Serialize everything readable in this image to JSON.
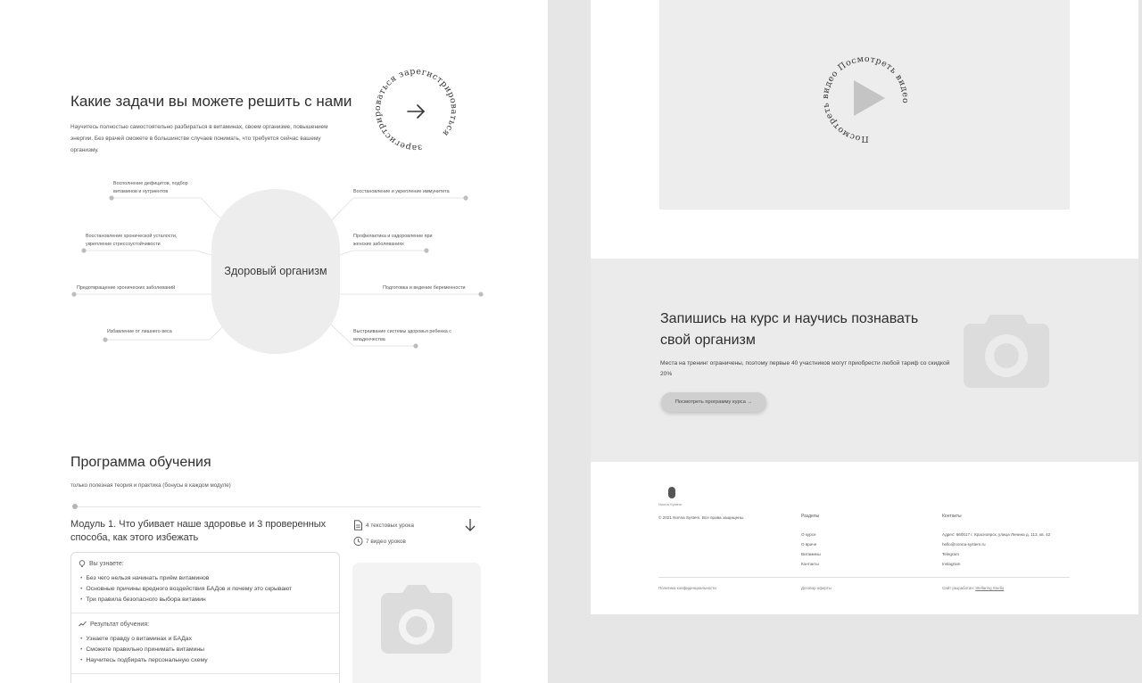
{
  "tasks": {
    "title": "Какие задачи вы можете решить с нами",
    "description": "Научитесь полностью самостоятельно разбираться в витаминах, своем организме, повышением энергии. Без врачей сможете в большинстве случаев понимать, что требуется сейчас вашему организму.",
    "register_ring_text": "зарегистрироваться зарегистрироваться",
    "center_label": "Здоровый организм",
    "nodes_left": [
      "Восполнение дефицитов, подбор витаминов и нутриентов",
      "Восстановление хронической усталости, укрепление стрессоустойчивости",
      "Предотвращение хронических заболеваний",
      "Избавление от лишнего веса"
    ],
    "nodes_right": [
      "Восстановление и укрепление иммунитета",
      "Профилактика и оздоровление при женских заболеваниях",
      "Подготовка и ведение беременности",
      "Выстраивание системы здоровья ребенка с младенчества"
    ]
  },
  "program": {
    "title": "Программа обучения",
    "subtitle": "только полезная теория и практика (бонусы в каждом модуле)",
    "module": {
      "title": "Модуль 1. Что убивает наше здоровье и 3 проверенных способа, как этого избежать",
      "text_lessons": "4 текстовых урока",
      "video_lessons": "7 видео уроков",
      "learn_heading": "Вы узнаете:",
      "learn_items": [
        "Без чего нельзя начинать приём витаминов",
        "Основные причины вредного воздействия БАДов и почему это скрывают",
        "Три правила безопасного выбора витамин"
      ],
      "result_heading": "Результат обучения:",
      "result_items": [
        "Узнаете правду о витаминах и БАДах",
        "Сможете правильно принимать витамины",
        "Научитесь подбирать персональную схему"
      ]
    }
  },
  "video": {
    "ring_text": "Посмотреть видео Посмотреть видео"
  },
  "signup": {
    "title": "Запишись на курс и научись познавать свой организм",
    "description": "Места на тренинг ограничены, поэтому первые 40 участников могут приобрести любой тариф со скидкой 20%",
    "button_label": "Посмотреть программу курса →"
  },
  "footer": {
    "brand": "Nonna System",
    "copyright": "© 2021 Nonna System. Все права защищены.",
    "sections_heading": "Разделы",
    "sections": [
      "О курсе",
      "О враче",
      "Витамины",
      "Контакты"
    ],
    "contacts_heading": "Контакты",
    "contacts": [
      "Адрес: 660017 г. Красноярск, улица Ленина д. 113, кв. 42",
      "hello@nonna-system.ru",
      "Telegram",
      "Instagram"
    ],
    "privacy": "Политика конфиденциальности",
    "offer": "Договор оферты",
    "made_by_prefix": "Сайт разработан: ",
    "made_by_link": "Stellaring Studio"
  },
  "icons": {
    "register": "arrow-right-icon",
    "download": "arrow-down-icon",
    "document": "document-icon",
    "clock": "clock-icon",
    "bulb": "lightbulb-icon",
    "result": "result-icon",
    "play": "play-icon",
    "camera": "camera-placeholder-icon"
  }
}
